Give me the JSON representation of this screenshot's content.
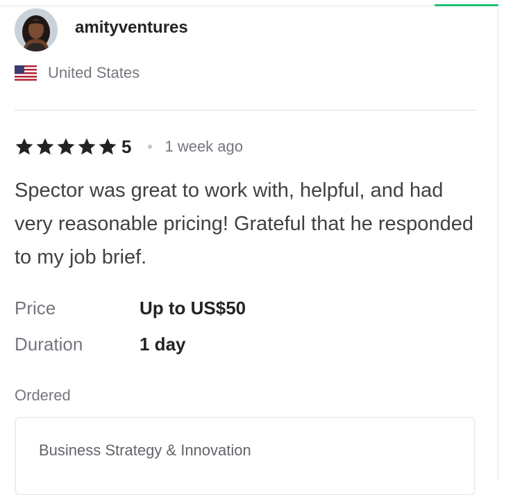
{
  "reviewer": {
    "username": "amityventures",
    "country": "United States",
    "flag_icon": "us-flag-icon"
  },
  "review": {
    "rating": "5",
    "stars": 5,
    "time_ago": "1 week ago",
    "text": "Spector was great to work with, helpful, and had very reasonable pricing! Grateful that he responded to my job brief."
  },
  "details": {
    "price_label": "Price",
    "price_value": "Up to US$50",
    "duration_label": "Duration",
    "duration_value": "1 day"
  },
  "ordered": {
    "label": "Ordered",
    "service": "Business Strategy & Innovation"
  },
  "colors": {
    "accent": "#1dbf73",
    "text_primary": "#222325",
    "text_secondary": "#74767e"
  }
}
